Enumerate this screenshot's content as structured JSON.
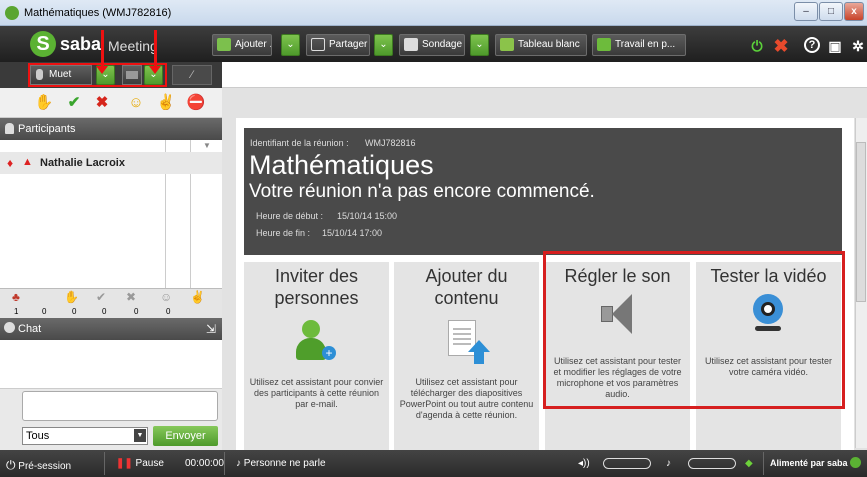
{
  "window": {
    "title": "Mathématiques (WMJ782816)"
  },
  "appbar": {
    "logo_saba": "saba",
    "logo_meeting": "Meeting",
    "buttons": [
      {
        "label": "Ajouter ...",
        "icon": "add-icon"
      },
      {
        "label": "Partager",
        "icon": "screen-icon"
      },
      {
        "label": "Sondage",
        "icon": "poll-icon"
      },
      {
        "label": "Tableau blanc",
        "icon": "whiteboard-icon"
      },
      {
        "label": "Travail en p...",
        "icon": "group-icon"
      }
    ]
  },
  "audio": {
    "mute_label": "Muet"
  },
  "participants": {
    "header": "Participants",
    "list": [
      {
        "name": "Nathalie Lacroix"
      }
    ],
    "stats": [
      "1",
      "0",
      "0",
      "0",
      "0",
      "0"
    ]
  },
  "chat": {
    "header": "Chat",
    "recipient": "Tous",
    "send_label": "Envoyer"
  },
  "meeting": {
    "id_label": "Identifiant de la réunion :",
    "id_value": "WMJ782816",
    "title": "Mathématiques",
    "status": "Votre réunion n'a pas encore commencé.",
    "start_label": "Heure de début :",
    "start_value": "15/10/14 15:00",
    "end_label": "Heure de fin :",
    "end_value": "15/10/14 17:00"
  },
  "tiles": [
    {
      "title": "Inviter des personnes",
      "desc": "Utilisez cet assistant pour convier des participants à cette réunion par e-mail.",
      "icon": "add-user-icon"
    },
    {
      "title": "Ajouter du contenu",
      "desc": "Utilisez cet assistant pour télécharger des diapositives PowerPoint ou tout autre contenu d'agenda à cette réunion.",
      "icon": "upload-document-icon"
    },
    {
      "title": "Régler le son",
      "desc": "Utilisez cet assistant pour tester et modifier les réglages de votre microphone et vos paramètres audio.",
      "icon": "speaker-icon"
    },
    {
      "title": "Tester la vidéo",
      "desc": "Utilisez cet assistant pour tester votre caméra vidéo.",
      "icon": "webcam-icon"
    }
  ],
  "statusbar": {
    "session_label": "Pré-session",
    "pause_label": "Pause",
    "timer": "00:00:00",
    "speaker_status": "Personne ne parle",
    "powered_by": "Alimenté par saba"
  },
  "colors": {
    "accent_green": "#5bb233",
    "highlight_red": "#d61f1f",
    "dark_bar": "#2a2a2a"
  }
}
